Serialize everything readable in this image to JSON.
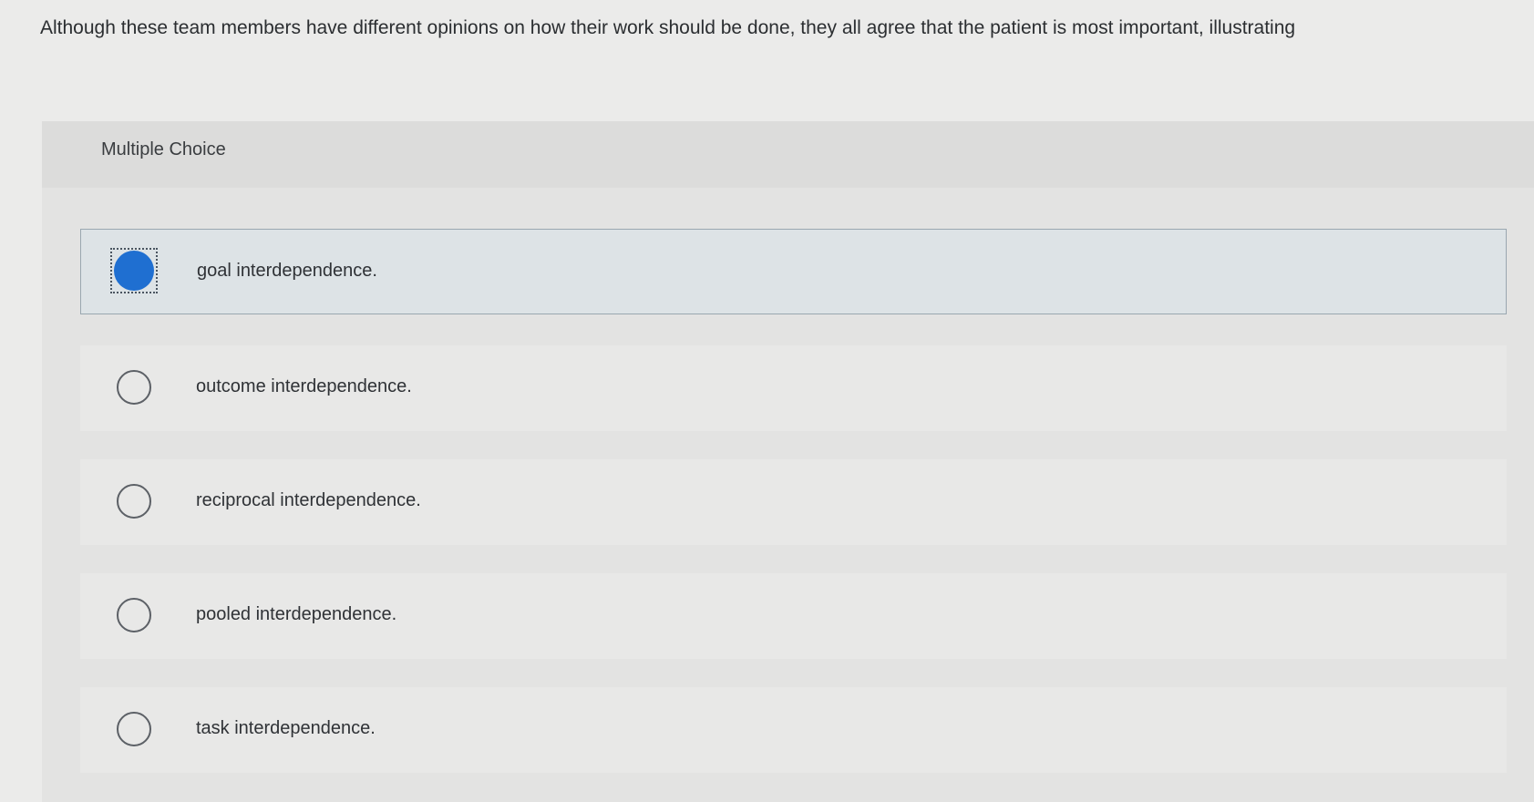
{
  "question": {
    "text": "Although these team members have different opinions on how their work should be done, they all agree that the patient is most important, illustrating"
  },
  "panel": {
    "title": "Multiple Choice"
  },
  "options": [
    {
      "label": "goal interdependence.",
      "selected": true
    },
    {
      "label": "outcome interdependence.",
      "selected": false
    },
    {
      "label": "reciprocal interdependence.",
      "selected": false
    },
    {
      "label": "pooled interdependence.",
      "selected": false
    },
    {
      "label": "task interdependence.",
      "selected": false
    }
  ],
  "colors": {
    "accent": "#1f6fd1",
    "selected_background": "#dde3e6",
    "page_background": "#ebebea"
  }
}
